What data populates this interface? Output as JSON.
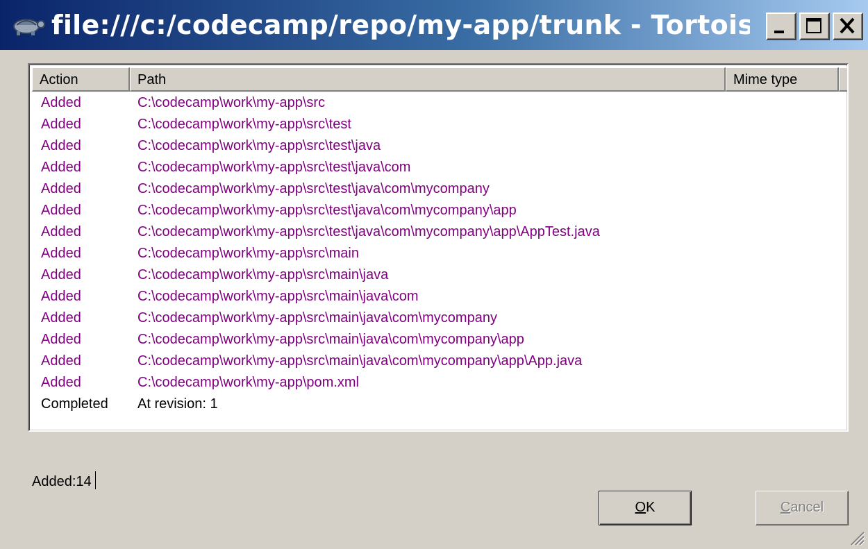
{
  "window": {
    "title": "file:///c:/codecamp/repo/my-app/trunk - TortoiseSV...",
    "app_icon": "tortoise-icon",
    "title_gradient": [
      "#0a246a",
      "#a6caf0"
    ]
  },
  "list": {
    "columns": [
      "Action",
      "Path",
      "Mime type"
    ],
    "added_color": "#800080",
    "rows": [
      {
        "action": "Added",
        "path": "C:\\codecamp\\work\\my-app\\src",
        "status": "added"
      },
      {
        "action": "Added",
        "path": "C:\\codecamp\\work\\my-app\\src\\test",
        "status": "added"
      },
      {
        "action": "Added",
        "path": "C:\\codecamp\\work\\my-app\\src\\test\\java",
        "status": "added"
      },
      {
        "action": "Added",
        "path": "C:\\codecamp\\work\\my-app\\src\\test\\java\\com",
        "status": "added"
      },
      {
        "action": "Added",
        "path": "C:\\codecamp\\work\\my-app\\src\\test\\java\\com\\mycompany",
        "status": "added"
      },
      {
        "action": "Added",
        "path": "C:\\codecamp\\work\\my-app\\src\\test\\java\\com\\mycompany\\app",
        "status": "added"
      },
      {
        "action": "Added",
        "path": "C:\\codecamp\\work\\my-app\\src\\test\\java\\com\\mycompany\\app\\AppTest.java",
        "status": "added"
      },
      {
        "action": "Added",
        "path": "C:\\codecamp\\work\\my-app\\src\\main",
        "status": "added"
      },
      {
        "action": "Added",
        "path": "C:\\codecamp\\work\\my-app\\src\\main\\java",
        "status": "added"
      },
      {
        "action": "Added",
        "path": "C:\\codecamp\\work\\my-app\\src\\main\\java\\com",
        "status": "added"
      },
      {
        "action": "Added",
        "path": "C:\\codecamp\\work\\my-app\\src\\main\\java\\com\\mycompany",
        "status": "added"
      },
      {
        "action": "Added",
        "path": "C:\\codecamp\\work\\my-app\\src\\main\\java\\com\\mycompany\\app",
        "status": "added"
      },
      {
        "action": "Added",
        "path": "C:\\codecamp\\work\\my-app\\src\\main\\java\\com\\mycompany\\app\\App.java",
        "status": "added"
      },
      {
        "action": "Added",
        "path": "C:\\codecamp\\work\\my-app\\pom.xml",
        "status": "added"
      },
      {
        "action": "Completed",
        "path": "At revision: 1",
        "status": "completed"
      }
    ]
  },
  "summary": {
    "text": "Added:14"
  },
  "buttons": {
    "ok_label": "OK",
    "cancel_label": "Cancel",
    "cancel_enabled": false
  }
}
